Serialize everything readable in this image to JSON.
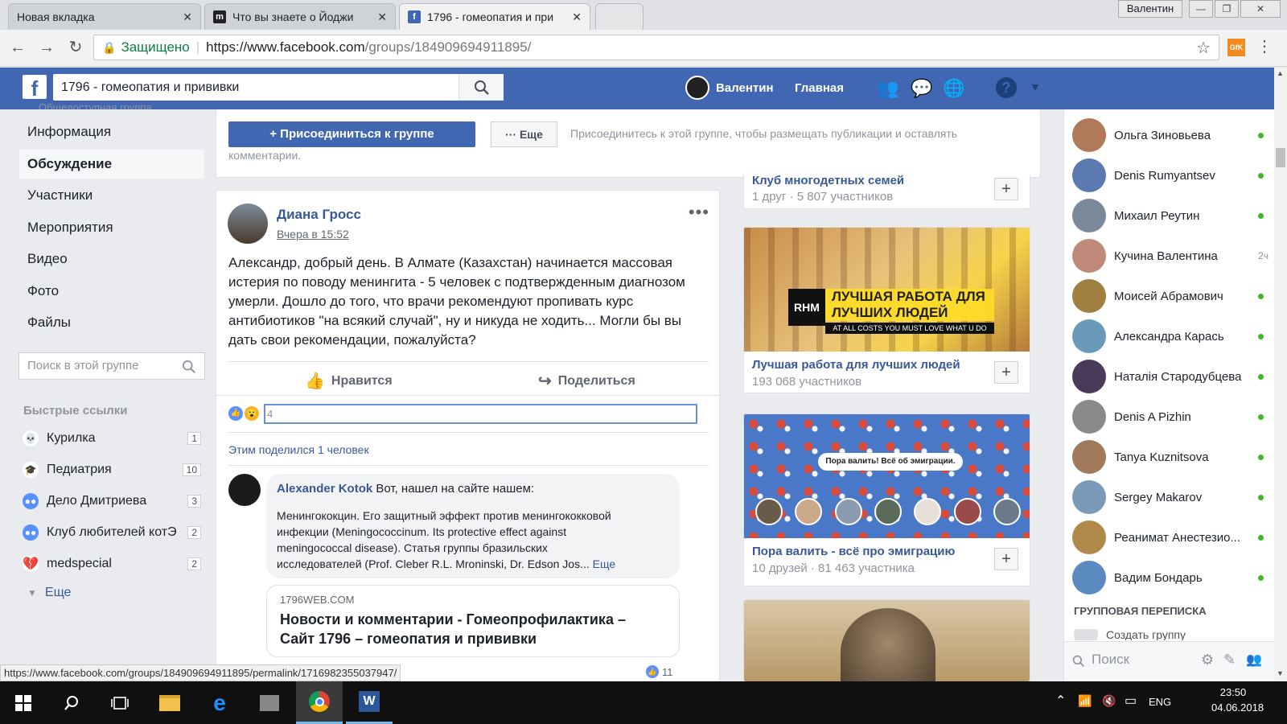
{
  "browser": {
    "tabs": [
      {
        "title": "Новая вкладка",
        "icon": "none"
      },
      {
        "title": "Что вы знаете о Йоджи",
        "icon": "m-logo-icon"
      },
      {
        "title": "1796 - гомеопатия и при",
        "icon": "facebook-icon"
      }
    ],
    "window_user": "Валентин",
    "secure_label": "Защищено",
    "url_host": "https://www.facebook.com",
    "url_path": "/groups/184909694911895/",
    "ext_label": "GfK",
    "status_url": "https://www.facebook.com/groups/184909694911895/permalink/1716982355037947/"
  },
  "fb": {
    "search_value": "1796 - гомеопатия и прививки",
    "user_name": "Валентин",
    "home": "Главная"
  },
  "left": {
    "cut_text": "Общедоступная группа",
    "nav": [
      "Информация",
      "Обсуждение",
      "Участники",
      "Мероприятия",
      "Видео",
      "Фото",
      "Файлы"
    ],
    "search_placeholder": "Поиск в этой группе",
    "quick_title": "Быстрые ссылки",
    "quick": [
      {
        "name": "Курилка",
        "count": "1",
        "icon": "skull-icon"
      },
      {
        "name": "Педиатрия",
        "count": "10",
        "icon": "graduation-cap-icon"
      },
      {
        "name": "Дело Дмитриева",
        "count": "3",
        "icon": "group-icon"
      },
      {
        "name": "Клуб любителей котЭ",
        "count": "2",
        "icon": "group-icon"
      },
      {
        "name": "medspecial",
        "count": "2",
        "icon": "broken-heart-icon"
      }
    ],
    "more": "Еще"
  },
  "join": {
    "button": "+ Присоединиться к группе",
    "more": "··· Еще",
    "hint_line1": "Присоединитесь к этой группе, чтобы размещать публикации и оставлять",
    "hint_line2": "комментарии."
  },
  "post": {
    "author": "Диана Гросс",
    "time": "Вчера в 15:52",
    "text": [
      "Александр, добрый день. В Алмате (Казахстан) начинается массовая",
      "истерия по поводу менингита - 5 человек с подтвержденным диагнозом",
      "умерли. Дошло до того, что врачи рекомендуют пропивать курс",
      "антибиотиков \"на всякий случай\", ну и никуда не ходить... Могли бы вы",
      "дать свои рекомендации, пожалуйста?"
    ],
    "like": "Нравится",
    "share": "Поделиться",
    "reactions_count": "4",
    "shared_by": "Этим поделился 1 человек",
    "comment": {
      "author": "Alexander Kotok",
      "lead": "Вот, нашел на сайте нашем:",
      "body": [
        "Менингококцин. Его защитный эффект против менингококковой",
        "инфекции (Meningococcinum. Its protective effect against",
        "meningococcal disease). Статья группы бразильских",
        "исследователей (Prof. Cleber R.L. Mroninski, Dr. Edson Jos..."
      ],
      "more": "Еще",
      "link_domain": "1796WEB.COM",
      "link_title1": "Новости и комментарии - Гомеопрофилактика –",
      "link_title2": "Сайт 1796 – гомеопатия и прививки",
      "likes": "11"
    }
  },
  "groups": [
    {
      "name": "Клуб многодетных семей",
      "meta": "1 друг · 5 807 участников"
    },
    {
      "name": "Лучшая работа для лучших людей",
      "meta": "193 068 участников",
      "banner_logo": "RHM",
      "banner_line1": "ЛУЧШАЯ РАБОТА ДЛЯ",
      "banner_line2": "ЛУЧШИХ ЛЮДЕЙ",
      "banner_sub": "AT ALL COSTS YOU MUST LOVE WHAT U DO"
    },
    {
      "name": "Пора валить - всё про эмиграцию",
      "meta": "10 друзей · 81 463 участника",
      "banner_text": "Пора валить! Всё об эмиграции."
    }
  ],
  "chat": {
    "contacts": [
      {
        "name": "Ольга Зиновьева",
        "status": "online"
      },
      {
        "name": "Denis Rumyantsev",
        "status": "online"
      },
      {
        "name": "Михаил Реутин",
        "status": "online"
      },
      {
        "name": "Кучина Валентина",
        "status": "2ч"
      },
      {
        "name": "Моисей Абрамович",
        "status": "online"
      },
      {
        "name": "Александра Карась",
        "status": "online"
      },
      {
        "name": "Наталія Стародубцева",
        "status": "online"
      },
      {
        "name": "Denis A Pizhin",
        "status": "online"
      },
      {
        "name": "Tanya Kuznitsova",
        "status": "online"
      },
      {
        "name": "Sergey Makarov",
        "status": "online"
      },
      {
        "name": "Реанимат Анестезио...",
        "status": "online"
      },
      {
        "name": "Вадим Бондарь",
        "status": "online"
      }
    ],
    "group_title": "ГРУППОВАЯ ПЕРЕПИСКА",
    "create_group": "Создать группу",
    "search_placeholder": "Поиск"
  },
  "taskbar": {
    "lang": "ENG",
    "time": "23:50",
    "date": "04.06.2018"
  },
  "colors": {
    "fb_blue": "#4267b2",
    "online": "#42b72a",
    "link": "#385898"
  }
}
